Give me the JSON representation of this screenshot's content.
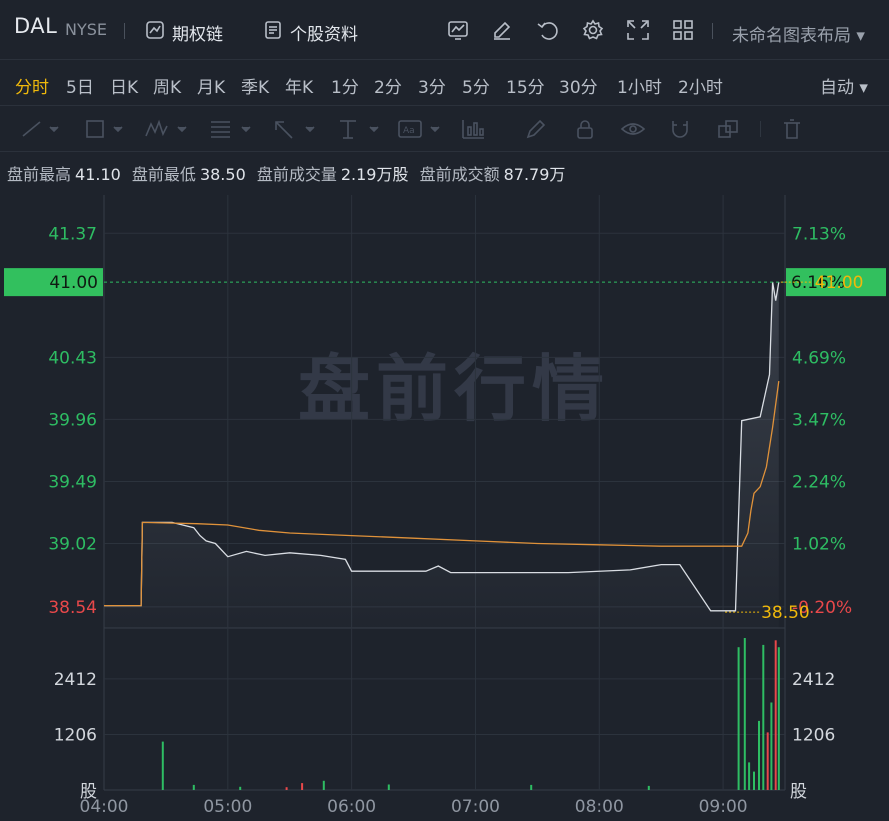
{
  "header": {
    "symbol": "DAL",
    "exchange": "NYSE",
    "option_chain_label": "期权链",
    "profile_label": "个股资料",
    "layout_label": "未命名图表布局"
  },
  "periods": {
    "items": [
      "分时",
      "5日",
      "日K",
      "周K",
      "月K",
      "季K",
      "年K",
      "1分",
      "2分",
      "3分",
      "5分",
      "15分",
      "30分",
      "1小时",
      "2小时"
    ],
    "active": "分时",
    "auto_label": "自动"
  },
  "stats": {
    "high_label": "盘前最高",
    "high": "41.10",
    "low_label": "盘前最低",
    "low": "38.50",
    "vol_label": "盘前成交量",
    "vol": "2.19万股",
    "amt_label": "盘前成交额",
    "amt": "87.79万"
  },
  "watermark": "盘前行情",
  "colors": {
    "up": "#2ebd63",
    "down": "#e8484a",
    "accent": "#f0b90b",
    "price_line": "#d9dde3",
    "avg_line": "#e0923a"
  },
  "chart_data": {
    "type": "line",
    "x_ticks": [
      "04:00",
      "05:00",
      "06:00",
      "07:00",
      "08:00",
      "09:00"
    ],
    "price_ticks_left": [
      "41.37",
      "40.43",
      "39.96",
      "39.49",
      "39.02",
      "38.54"
    ],
    "pct_ticks_right": [
      "7.13%",
      "4.69%",
      "3.47%",
      "2.24%",
      "1.02%",
      "-0.20%"
    ],
    "current_price": "41.00",
    "current_pct": "6.16%",
    "high_marker": "41.00",
    "low_marker": "38.50",
    "ylim": [
      38.38,
      41.66
    ],
    "vol_ticks": [
      "2412",
      "1206"
    ],
    "vol_unit": "股",
    "price_series": {
      "x": [
        0,
        0.6,
        0.62,
        1.1,
        1.45,
        1.55,
        1.65,
        1.8,
        2.0,
        2.3,
        2.6,
        3.0,
        3.5,
        3.9,
        4.0,
        4.2,
        5.2,
        5.4,
        5.6,
        6.5,
        7.5,
        8.5,
        9.0,
        9.3,
        9.8,
        10.0,
        10.2,
        10.3,
        10.6,
        10.75,
        10.8,
        10.85,
        10.9
      ],
      "y": [
        38.55,
        38.55,
        39.18,
        39.18,
        39.14,
        39.08,
        39.04,
        39.02,
        38.92,
        38.96,
        38.93,
        38.95,
        38.93,
        38.9,
        38.81,
        38.81,
        38.81,
        38.85,
        38.8,
        38.8,
        38.8,
        38.82,
        38.86,
        38.86,
        38.51,
        38.51,
        38.51,
        39.95,
        39.98,
        40.3,
        41.0,
        40.86,
        41.0
      ]
    },
    "avg_series": {
      "x": [
        0,
        0.6,
        0.62,
        1.5,
        2.0,
        2.5,
        3.0,
        4.0,
        5.0,
        6.0,
        7.0,
        8.0,
        9.0,
        10.3,
        10.4,
        10.45,
        10.5,
        10.6,
        10.7,
        10.8,
        10.9
      ],
      "y": [
        38.55,
        38.55,
        39.18,
        39.17,
        39.16,
        39.12,
        39.1,
        39.08,
        39.06,
        39.04,
        39.02,
        39.01,
        39.0,
        39.0,
        39.1,
        39.27,
        39.4,
        39.45,
        39.6,
        39.9,
        40.25
      ]
    },
    "volume_bars": [
      {
        "x": 0.95,
        "v": 1050,
        "c": "up"
      },
      {
        "x": 1.45,
        "v": 110,
        "c": "up"
      },
      {
        "x": 2.2,
        "v": 70,
        "c": "up"
      },
      {
        "x": 2.95,
        "v": 60,
        "c": "down"
      },
      {
        "x": 3.2,
        "v": 150,
        "c": "down"
      },
      {
        "x": 3.55,
        "v": 200,
        "c": "up"
      },
      {
        "x": 4.6,
        "v": 120,
        "c": "up"
      },
      {
        "x": 6.9,
        "v": 110,
        "c": "up"
      },
      {
        "x": 8.8,
        "v": 90,
        "c": "up"
      },
      {
        "x": 10.25,
        "v": 3100,
        "c": "up"
      },
      {
        "x": 10.35,
        "v": 3300,
        "c": "up"
      },
      {
        "x": 10.42,
        "v": 600,
        "c": "up"
      },
      {
        "x": 10.5,
        "v": 400,
        "c": "up"
      },
      {
        "x": 10.58,
        "v": 1500,
        "c": "up"
      },
      {
        "x": 10.65,
        "v": 3150,
        "c": "up"
      },
      {
        "x": 10.72,
        "v": 1250,
        "c": "down"
      },
      {
        "x": 10.78,
        "v": 1900,
        "c": "up"
      },
      {
        "x": 10.85,
        "v": 3250,
        "c": "down"
      },
      {
        "x": 10.9,
        "v": 3100,
        "c": "up"
      }
    ],
    "vol_max": 3300,
    "x_range_hours_per_tick": 1
  }
}
